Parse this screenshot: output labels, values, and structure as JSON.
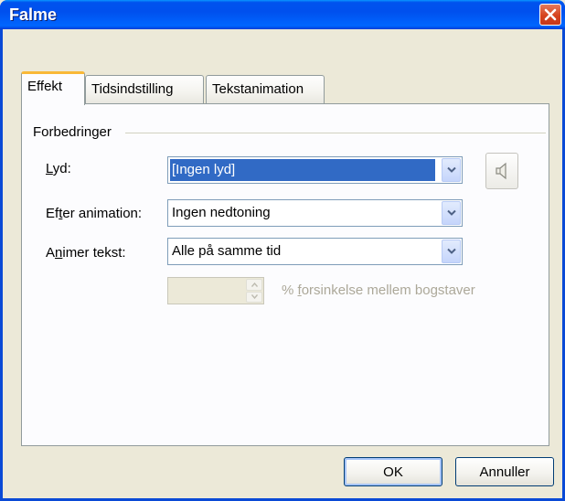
{
  "window": {
    "title": "Falme"
  },
  "tabs": [
    {
      "label": "Effekt",
      "active": true
    },
    {
      "label": "Tidsindstilling",
      "active": false
    },
    {
      "label": "Tekstanimation",
      "active": false
    }
  ],
  "group": {
    "label": "Forbedringer"
  },
  "fields": {
    "sound": {
      "label_pre": "",
      "label_u": "L",
      "label_post": "yd:",
      "value": "[Ingen lyd]"
    },
    "after_animation": {
      "label_pre": "Ef",
      "label_u": "t",
      "label_post": "er animation:",
      "value": "Ingen nedtoning"
    },
    "animate_text": {
      "label_pre": "A",
      "label_u": "n",
      "label_post": "imer tekst:",
      "value": "Alle på samme tid"
    },
    "delay": {
      "value": "",
      "label_pre": "% ",
      "label_u": "f",
      "label_post": "orsinkelse mellem bogstaver"
    }
  },
  "buttons": {
    "ok": "OK",
    "cancel": "Annuller"
  },
  "icons": {
    "close": "close-icon",
    "speaker": "speaker-icon",
    "dropdown": "chevron-down-icon"
  },
  "colors": {
    "titlebar": "#0054e3",
    "selection": "#316ac5",
    "tab_highlight": "#f9b837"
  }
}
